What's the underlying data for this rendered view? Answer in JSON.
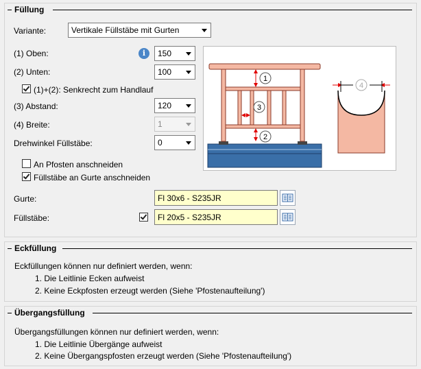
{
  "fuellung": {
    "title": "Füllung",
    "variante": {
      "label": "Variante:",
      "value": "Vertikale Füllstäbe mit Gurten"
    },
    "oben": {
      "label": "(1) Oben:",
      "value": "150"
    },
    "unten": {
      "label": "(2) Unten:",
      "value": "100"
    },
    "senkrecht": {
      "label": "(1)+(2): Senkrecht zum Handlauf",
      "checked": true
    },
    "abstand": {
      "label": "(3) Abstand:",
      "value": "120"
    },
    "breite": {
      "label": "(4) Breite:",
      "value": "1"
    },
    "drehwinkel": {
      "label": "Drehwinkel Füllstäbe:",
      "value": "0"
    },
    "pfosten": {
      "label": "An Pfosten anschneiden",
      "checked": false
    },
    "gurte_cut": {
      "label": "Füllstäbe an Gurte anschneiden",
      "checked": true
    },
    "gurte": {
      "label": "Gurte:",
      "value": "Fl 30x6 - S235JR"
    },
    "fuellstaebe": {
      "label": "Füllstäbe:",
      "value": "Fl 20x5 - S235JR",
      "checked": true
    },
    "diagram_labels": {
      "one": "1",
      "two": "2",
      "three": "3",
      "four": "4"
    }
  },
  "eckfuellung": {
    "title": "Eckfüllung",
    "intro": "Eckfüllungen können nur definiert werden, wenn:",
    "items": [
      "1. Die Leitlinie Ecken aufweist",
      "2. Keine Eckpfosten erzeugt werden (Siehe 'Pfostenaufteilung')"
    ]
  },
  "uebergang": {
    "title": "Übergangsfüllung",
    "intro": "Übergangsfüllungen können nur definiert werden, wenn:",
    "items": [
      "1. Die Leitlinie Übergänge aufweist",
      "2. Keine Übergangspfosten erzeugt werden (Siehe 'Pfostenaufteilung')"
    ]
  },
  "colors": {
    "rail": "#f4b8a3",
    "rail_stroke": "#8a3a2a",
    "slab": "#3a6fa8",
    "arrow": "#e00000"
  }
}
